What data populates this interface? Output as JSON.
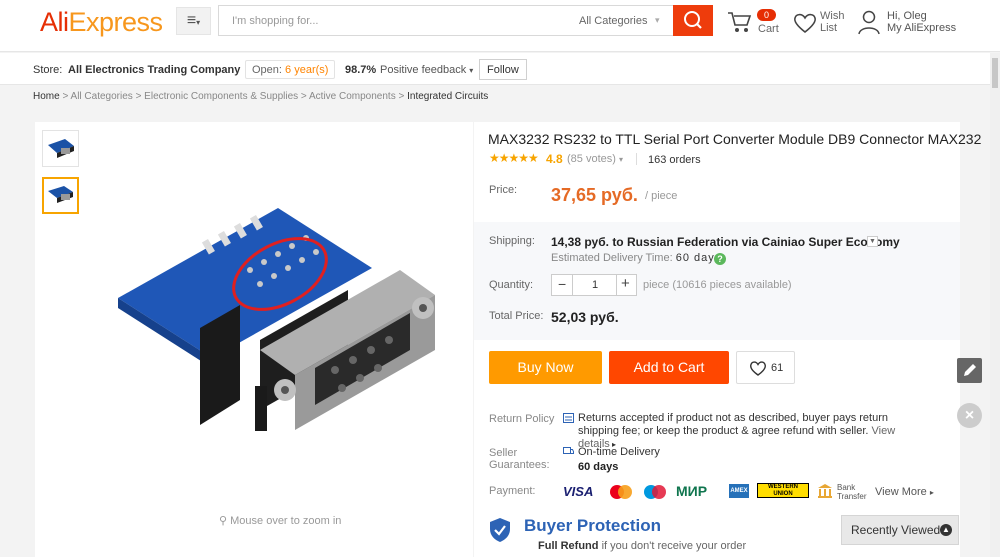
{
  "header": {
    "logo_part1": "Ali",
    "logo_part2": "Express",
    "search_placeholder": "I'm shopping for...",
    "search_category": "All Categories",
    "cart_count": "0",
    "cart_label": "Cart",
    "wish_line1": "Wish",
    "wish_line2": "List",
    "user_greeting": "Hi, Oleg",
    "user_link": "My AliExpress"
  },
  "store": {
    "label": "Store:",
    "name": "All Electronics Trading Company",
    "open_label": "Open:",
    "open_years": "6 year(s)",
    "feedback_pct": "98.7%",
    "feedback_label": "Positive feedback",
    "follow": "Follow"
  },
  "breadcrumb": {
    "home": "Home",
    "path": "> All Categories > Electronic Components & Supplies > Active Components >",
    "current": "Integrated Circuits"
  },
  "gallery": {
    "zoom_hint": "Mouse over to zoom in"
  },
  "product": {
    "title": "MAX3232 RS232 to TTL Serial Port Converter Module DB9 Connector MAX232",
    "rating": "4.8",
    "votes": "(85 votes)",
    "orders": "163 orders",
    "price_label": "Price:",
    "price": "37,65 руб.",
    "price_unit": "/ piece",
    "shipping_label": "Shipping:",
    "shipping_cost": "14,38 руб.",
    "shipping_text": "to Russian Federation via Cainiao Super Economy",
    "est_label": "Estimated Delivery Time:",
    "est_days": "60 days",
    "quantity_label": "Quantity:",
    "quantity_value": "1",
    "availability": "piece (10616 pieces available)",
    "total_label": "Total Price:",
    "total": "52,03 руб.",
    "buy_now": "Buy Now",
    "add_to_cart": "Add to Cart",
    "wish_count": "61",
    "return_label": "Return Policy",
    "return_text": "Returns accepted if product not as described, buyer pays return shipping fee; or keep the product & agree refund with seller.",
    "view_details": "View details",
    "seller_label_1": "Seller",
    "seller_label_2": "Guarantees:",
    "ontime": "On-time Delivery",
    "ontime_days": "60 days",
    "payment_label": "Payment:",
    "pay_visa": "VISA",
    "pay_mir": "МИР",
    "pay_amex": "AMEX",
    "pay_wu_1": "WESTERN",
    "pay_wu_2": "UNION",
    "pay_bank_1": "Bank",
    "pay_bank_2": "Transfer",
    "view_more": "View More",
    "buyer_protection": "Buyer Protection",
    "full_refund": "Full Refund",
    "full_refund_tail": "if you don't receive your order"
  },
  "side": {
    "recently_viewed": "Recently Viewed"
  },
  "colors": {
    "brand_red": "#e62e04",
    "brand_orange": "#f7971d",
    "buy_now": "#ff9a00",
    "add_to_cart": "#ff4700",
    "price": "#e56a25"
  }
}
